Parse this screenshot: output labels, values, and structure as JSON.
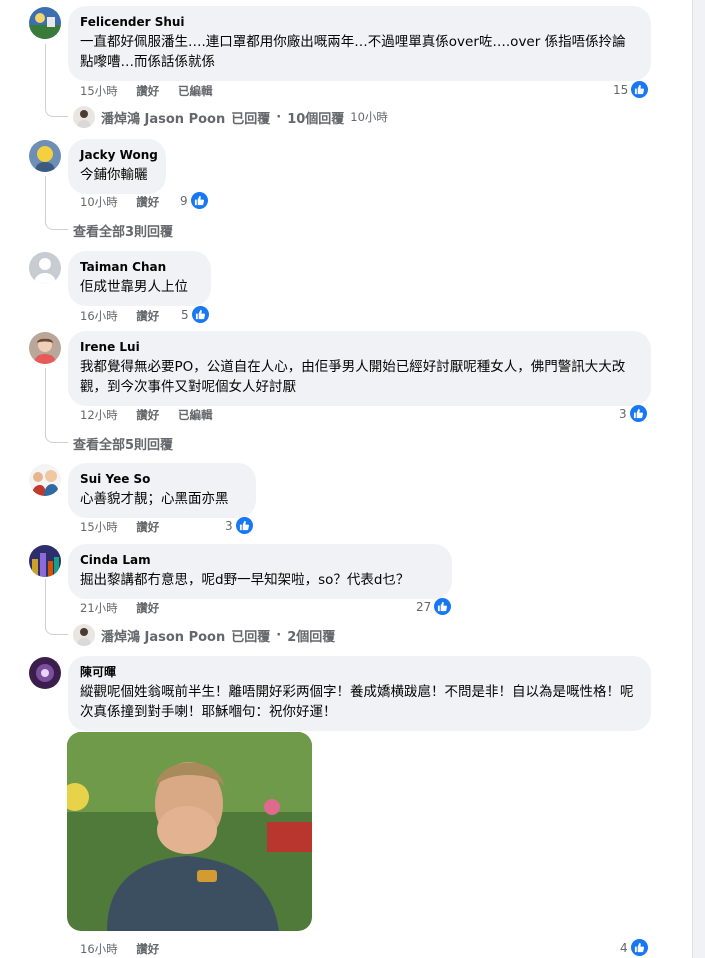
{
  "comments": [
    {
      "author": "Felicender Shui",
      "text": "一直都好佩服潘生….連口罩都用你廠出嘅兩年…不過哩單真係over咗….over 係指唔係拎論點嚟嘈…而係話係就係",
      "time": "15小時",
      "like_label": "讚好",
      "edited": "已編輯",
      "likes": "15"
    },
    {
      "author": "Jacky Wong",
      "text": "今鋪你輸曬",
      "time": "10小時",
      "like_label": "讚好",
      "likes": "9"
    },
    {
      "author": "Taiman Chan",
      "text": "佢成世靠男人上位",
      "time": "16小時",
      "like_label": "讚好",
      "likes": "5"
    },
    {
      "author": "Irene Lui",
      "text": "我都覺得無必要PO，公道自在人心，由佢爭男人開始已經好討厭呢種女人，佛門警訊大大改觀，到今次事件又對呢個女人好討厭",
      "time": "12小時",
      "like_label": "讚好",
      "edited": "已編輯",
      "likes": "3"
    },
    {
      "author": "Sui Yee So",
      "text": "心善貌才靚；心黑面亦黑",
      "time": "15小時",
      "like_label": "讚好",
      "likes": "3"
    },
    {
      "author": "Cinda Lam",
      "text": "掘出黎講都冇意思，呢d野一早知架啦，so？代表d乜？",
      "time": "21小時",
      "like_label": "讚好",
      "likes": "27"
    },
    {
      "author": "陳可暉",
      "text": "縱觀呢個姓翁嘅前半生！離唔開好彩两個字！養成嬌横跋扈！不問是非！自以為是嘅性格！呢次真係撞到對手喇！耶穌嗰句：祝你好運！",
      "time": "16小時",
      "like_label": "讚好",
      "likes": "4"
    }
  ],
  "reply_links": [
    {
      "name": "潘焯鴻 Jason Poon",
      "action": "已回覆",
      "count": "10個回覆",
      "time": "10小時"
    },
    {
      "label": "查看全部3則回覆"
    },
    {
      "label": "查看全部5則回覆"
    },
    {
      "name": "潘焯鴻 Jason Poon",
      "action": "已回覆",
      "count": "2個回覆"
    }
  ],
  "dot": "·",
  "colors": {
    "like_blue": "#1877f2",
    "bubble": "#f0f2f5",
    "meta": "#65676b"
  }
}
